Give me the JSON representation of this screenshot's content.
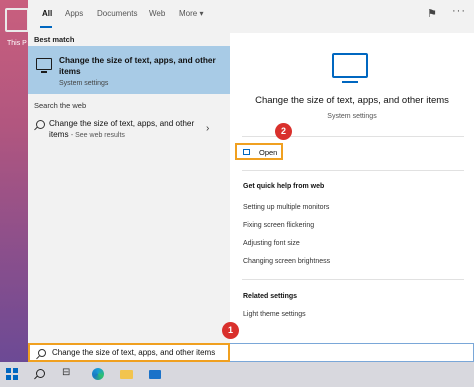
{
  "desktop": {
    "icon_label": "This P"
  },
  "tabs": [
    "All",
    "Apps",
    "Documents",
    "Web",
    "More ▾"
  ],
  "toolbar": {
    "feedback_icon": "feedback-icon",
    "more_label": "···"
  },
  "best_match": {
    "section": "Best match",
    "title": "Change the size of text, apps, and other items",
    "subtitle": "System settings"
  },
  "search_web": {
    "section": "Search the web",
    "title": "Change the size of text, apps, and other items",
    "subtitle": "- See web results"
  },
  "detail": {
    "title": "Change the size of text, apps, and other items",
    "subtitle": "System settings",
    "open_label": "Open",
    "quick_help_heading": "Get quick help from web",
    "quick_help_links": [
      "Setting up multiple monitors",
      "Fixing screen flickering",
      "Adjusting font size",
      "Changing screen brightness"
    ],
    "related_heading": "Related settings",
    "related_links": [
      "Light theme settings"
    ]
  },
  "search_box": {
    "value": "Change the size of text, apps, and other items"
  },
  "badges": {
    "first": "1",
    "second": "2"
  },
  "colors": {
    "accent": "#0067c0",
    "highlight": "#a8cbe6",
    "callout": "#f0a020",
    "badge": "#d9302c"
  }
}
